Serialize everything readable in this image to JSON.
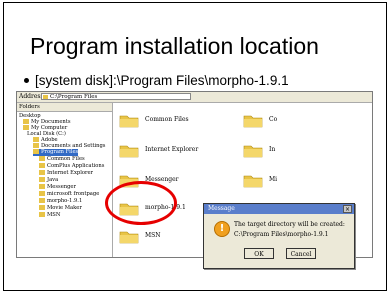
{
  "slide": {
    "title": "Program installation location",
    "bullet": "[system disk]:\\Program Files\\morpho-1.9.1"
  },
  "explorer": {
    "address_label": "Address",
    "address_value": "C:\\Program Files",
    "tree_header": "Folders",
    "tree_items": [
      "Desktop",
      "My Documents",
      "My Computer",
      "Local Disk (C:)",
      "Adobe",
      "Documents and Settings",
      "Program Files",
      "Common Files",
      "ComPlus Applications",
      "Internet Explorer",
      "Java",
      "Messenger",
      "microsoft frontpage",
      "morpho-1.9.1",
      "Movie Maker",
      "MSN"
    ],
    "folders": [
      "Common Files",
      "Internet Explorer",
      "Messenger",
      "morpho-1.9.1",
      "MSN",
      "Co",
      "In",
      "Mi",
      "Mi"
    ]
  },
  "dialog": {
    "title": "Message",
    "close": "×",
    "line1": "The target directory will be created:",
    "line2": "C:\\Program Files\\morpho-1.9.1",
    "ok": "OK",
    "cancel": "Cancel"
  },
  "colors": {
    "folder": "#e8c447",
    "highlight": "#e60000",
    "titlebar": "#5a7ecb"
  }
}
